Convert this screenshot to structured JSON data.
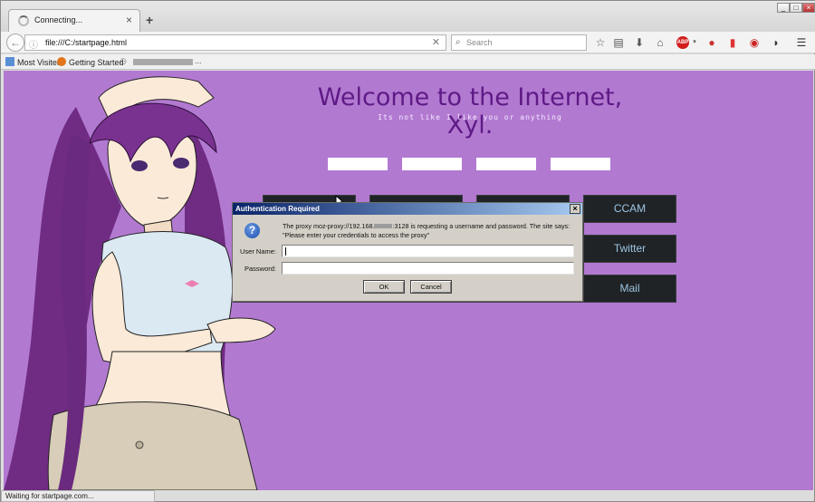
{
  "window": {
    "min": "_",
    "max": "□",
    "close": "×"
  },
  "tab": {
    "title": "Connecting...",
    "close": "×",
    "new_tab": "+"
  },
  "nav": {
    "back": "←",
    "url": "file:///C:/startpage.html",
    "search_placeholder": "Search"
  },
  "toolbar": {
    "icons": [
      "star-icon",
      "reading-list-icon",
      "download-icon",
      "home-icon",
      "abp-icon",
      "extension-icon",
      "extension-icon",
      "extension-icon",
      "pocket-icon",
      "menu-icon"
    ],
    "abp_label": "ABP"
  },
  "bookmarks": [
    {
      "label": "Most Visited"
    },
    {
      "label": "Getting Started"
    }
  ],
  "bookmarks_more": "...",
  "page": {
    "welcome": "Welcome to the Internet, Xyl.",
    "tagline": "Its not like I like you or anything",
    "buttons": [
      "CCAM",
      "Twitter",
      "Mail"
    ]
  },
  "status": "Waiting for startpage.com...",
  "dialog": {
    "title": "Authentication Required",
    "close": "×",
    "msg_pre": "The proxy moz-proxy://192.168.",
    "msg_post": ":3128 is requesting a username and password. The site says: \"Please enter your credentials to access the proxy\"",
    "username_label": "User Name:",
    "password_label": "Password:",
    "username_value": "",
    "password_value": "",
    "ok": "OK",
    "cancel": "Cancel"
  },
  "colors": {
    "page_bg": "#b279d1",
    "welcome": "#5f1a86",
    "dark_button": "#202326",
    "dark_button_text": "#9cc5e3"
  }
}
